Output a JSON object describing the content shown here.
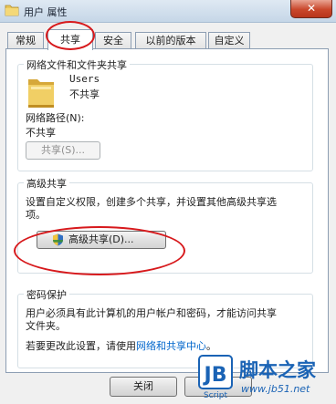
{
  "window": {
    "title": "用户 属性",
    "close_label": "✕"
  },
  "tabs": [
    {
      "label": "常规"
    },
    {
      "label": "共享"
    },
    {
      "label": "安全"
    },
    {
      "label": "以前的版本"
    },
    {
      "label": "自定义"
    }
  ],
  "network_sharing": {
    "group_title": "网络文件和文件夹共享",
    "folder_name": "Users",
    "folder_status": "不共享",
    "network_path_label": "网络路径(N):",
    "network_path_value": "不共享",
    "share_button": "共享(S)..."
  },
  "advanced_sharing": {
    "group_title": "高级共享",
    "description": "设置自定义权限，创建多个共享，并设置其他高级共享选项。",
    "description_line1": "设置自定义权限，创建多个共享，并设置其他高级共享选",
    "description_line2": "项。",
    "button": "高级共享(D)..."
  },
  "password_protection": {
    "group_title": "密码保护",
    "line1": "用户必须具有此计算机的用户帐户和密码，才能访问共享",
    "line2": "文件夹。",
    "change_prefix": "若要更改此设置，请使用",
    "change_link": "网络和共享中心",
    "change_suffix": "。"
  },
  "footer": {
    "close_button": "关闭"
  },
  "watermark": {
    "logo_letters": "JB",
    "logo_sub": "Script",
    "site_name": "脚本之家",
    "site_url": "www.jb51.net"
  },
  "colors": {
    "annotation": "#d7191c",
    "link": "#0066cc",
    "watermark": "#1a63b5"
  }
}
